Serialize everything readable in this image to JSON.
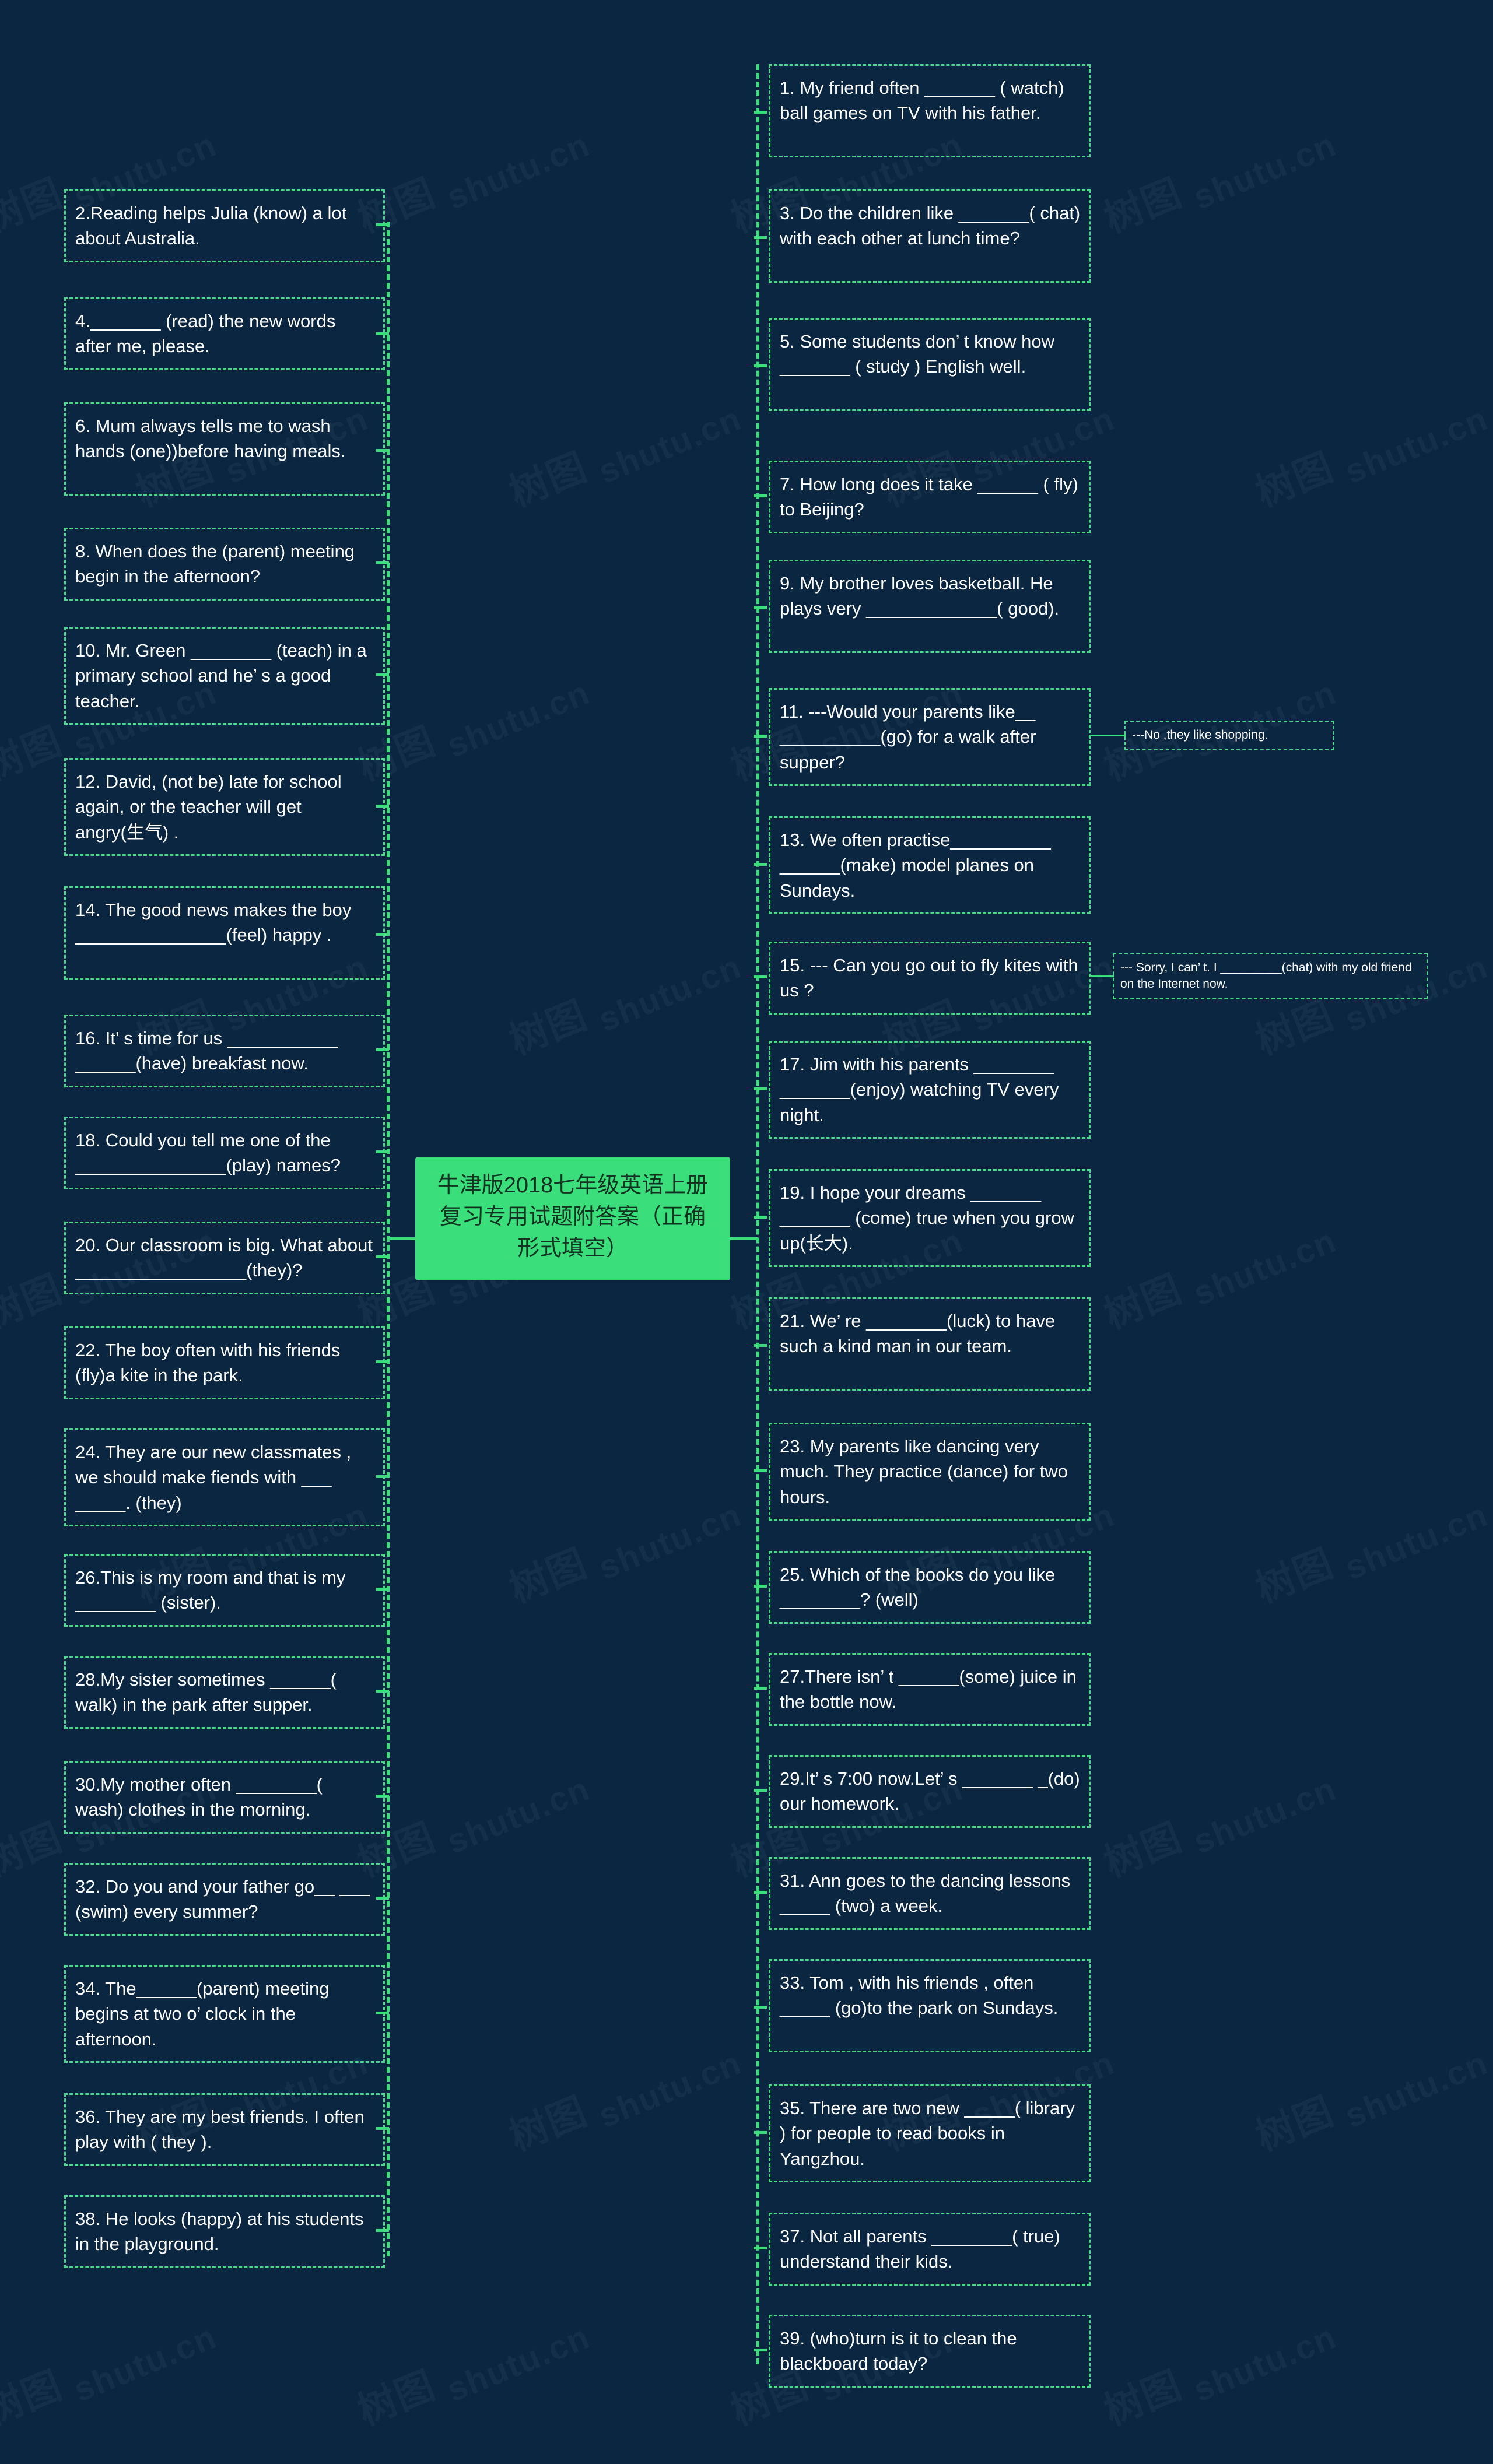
{
  "root": {
    "title": "牛津版2018七年级英语上册复习专用试题附答案（正确形式填空）",
    "color": "#3ade7b"
  },
  "theme": {
    "background": "#0a2641",
    "accent": "#3ade7b",
    "border": "#49d98a",
    "text": "#ffffff"
  },
  "watermark": {
    "latin": "shutu.cn",
    "cjk": "树图"
  },
  "left_branch": [
    {
      "id": "q2",
      "text": "2.Reading helps Julia (know) a lot about Australia."
    },
    {
      "id": "q4",
      "text": "4._______ (read) the new words  after me, please."
    },
    {
      "id": "q6",
      "text": "6. Mum always tells me to wash hands (one))before having meals."
    },
    {
      "id": "q8",
      "text": "8. When does the (parent) meeting begin in the afternoon?"
    },
    {
      "id": "q10",
      "text": "10. Mr. Green ________ (teach) in a primary school and he’ s a good teacher."
    },
    {
      "id": "q12",
      "text": "12. David, (not be) late for school again, or the teacher will get angry(生气) ."
    },
    {
      "id": "q14",
      "text": "14. The good news makes the boy _______________(feel) happy ."
    },
    {
      "id": "q16",
      "text": "16. It’ s time for us ___________ ______(have) breakfast now."
    },
    {
      "id": "q18",
      "text": "18. Could you tell me one of the  _______________(play) names?"
    },
    {
      "id": "q20",
      "text": "20. Our classroom is big. What about _________________(they)?"
    },
    {
      "id": "q22",
      "text": "22. The boy often with his friends (fly)a kite in the park."
    },
    {
      "id": "q24",
      "text": "24. They are our new classmates , we should make fiends with ___ _____. (they)"
    },
    {
      "id": "q26",
      "text": "26.This is my room and that is my ________ (sister)."
    },
    {
      "id": "q28",
      "text": "28.My sister sometimes ______( walk) in the park after supper."
    },
    {
      "id": "q30",
      "text": "30.My mother often ________( wash) clothes in the morning."
    },
    {
      "id": "q32",
      "text": "32. Do you and your father go__ ___ (swim) every summer?"
    },
    {
      "id": "q34",
      "text": "34. The______(parent) meeting begins at two o’ clock in the afternoon."
    },
    {
      "id": "q36",
      "text": "36. They are my best friends. I often play with ( they )."
    },
    {
      "id": "q38",
      "text": "38. He looks (happy) at his students in the playground."
    }
  ],
  "right_branch": [
    {
      "id": "q1",
      "text": "1. My friend often _______ ( watch) ball games on TV with his father."
    },
    {
      "id": "q3",
      "text": "3. Do the children like _______( chat) with each other at lunch time?"
    },
    {
      "id": "q5",
      "text": "5. Some students don’ t know how _______ ( study ) English well."
    },
    {
      "id": "q7",
      "text": "7. How long does it take ______ ( fly) to Beijing?"
    },
    {
      "id": "q9",
      "text": "9. My brother loves basketball. He plays very _____________( good)."
    },
    {
      "id": "q11",
      "text": "11. ---Would your parents like__ __________(go) for a walk after supper?",
      "answer": "---No ,they like shopping."
    },
    {
      "id": "q13",
      "text": "13. We often practise__________ ______(make) model planes on Sundays."
    },
    {
      "id": "q15",
      "text": "15. --- Can you go out to fly kites with us ?",
      "answer": "--- Sorry, I can’ t. I _________(chat) with  my old friend on the Internet now."
    },
    {
      "id": "q17",
      "text": "17. Jim with his parents ________ _______(enjoy) watching TV every night."
    },
    {
      "id": "q19",
      "text": "19. I hope your dreams _______ _______ (come) true when you grow up(长大)."
    },
    {
      "id": "q21",
      "text": "21. We’ re ________(luck) to have such a kind man in our team."
    },
    {
      "id": "q23",
      "text": "23. My parents like dancing very  much. They practice (dance) for  two hours."
    },
    {
      "id": "q25",
      "text": "25. Which of the books do you like ________? (well)"
    },
    {
      "id": "q27",
      "text": "27.There isn’ t ______(some) juice in the bottle now."
    },
    {
      "id": "q29",
      "text": "29.It’ s 7:00 now.Let’ s _______ _(do) our homework."
    },
    {
      "id": "q31",
      "text": "31. Ann goes to the dancing lessons _____ (two) a week."
    },
    {
      "id": "q33",
      "text": "33. Tom , with his friends , often _____ (go)to the park on Sundays."
    },
    {
      "id": "q35",
      "text": "35. There are two new _____( library ) for people to read books in Yangzhou."
    },
    {
      "id": "q37",
      "text": "37. Not all parents ________( true) understand their kids."
    },
    {
      "id": "q39",
      "text": "39. (who)turn is it to clean the blackboard today?"
    }
  ]
}
